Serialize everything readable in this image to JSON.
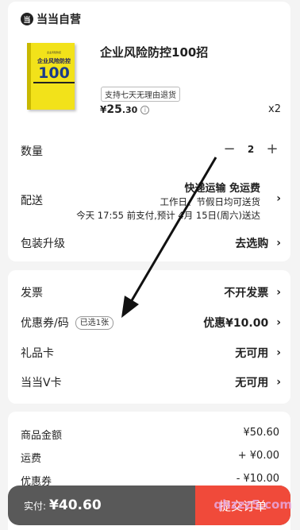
{
  "seller": {
    "logo_glyph": "当",
    "name": "当当自营"
  },
  "product": {
    "cover_top_text": "企业风险防控",
    "cover_title": "企业风险防控",
    "cover_number": "100",
    "title": "企业风险防控100招",
    "badge": "支持七天无理由退货",
    "price_symbol": "¥",
    "price_int": "25",
    "price_dec": ".30",
    "qty_label": "x2"
  },
  "quantity": {
    "label": "数量",
    "minus": "−",
    "value": "2",
    "plus": "+"
  },
  "delivery": {
    "label": "配送",
    "method": "快递运输 免运费",
    "note": "工作日、节假日均可送货",
    "eta": "今天 17:55 前支付,预计 4月 15日(周六)送达"
  },
  "packaging": {
    "label": "包装升级",
    "value": "去选购"
  },
  "invoice": {
    "label": "发票",
    "value": "不开发票"
  },
  "coupon": {
    "label": "优惠券/码",
    "tag": "已选1张",
    "value": "优惠¥10.00"
  },
  "giftcard": {
    "label": "礼品卡",
    "value": "无可用"
  },
  "vcard": {
    "label": "当当V卡",
    "value": "无可用"
  },
  "summary": {
    "goods_label": "商品金额",
    "goods_value": "¥50.60",
    "freight_label": "运费",
    "freight_value": "+ ¥0.00",
    "coupon_label": "优惠券",
    "coupon_value": "- ¥10.00"
  },
  "bottom": {
    "pay_label": "实付:",
    "pay_value": "¥40.60",
    "submit_label": "提交订单"
  },
  "watermark": "qhzzz5.com",
  "chevron": "›"
}
